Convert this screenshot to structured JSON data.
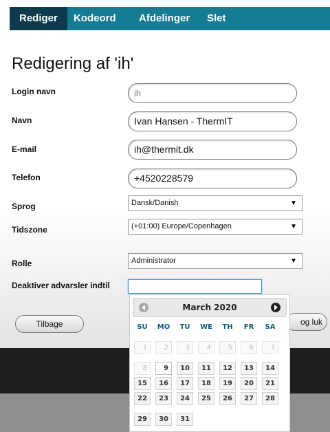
{
  "tabs": [
    {
      "label": "Rediger"
    },
    {
      "label": "Kodeord"
    },
    {
      "label": "Afdelinger"
    },
    {
      "label": "Slet"
    }
  ],
  "page_title": "Redigering af 'ih'",
  "form": {
    "login": {
      "label": "Login navn",
      "value": "ih"
    },
    "name": {
      "label": "Navn",
      "value": "Ivan Hansen - ThermIT"
    },
    "email": {
      "label": "E-mail",
      "value": "ih@thermit.dk"
    },
    "phone": {
      "label": "Telefon",
      "value": "+4520228579"
    },
    "language": {
      "label": "Sprog",
      "value": "Dansk/Danish"
    },
    "timezone": {
      "label": "Tidszone",
      "value": "(+01:00) Europe/Copenhagen"
    },
    "role": {
      "label": "Rolle",
      "value": "Administrator"
    },
    "disable_alerts": {
      "label": "Deaktiver advarsler indtil",
      "value": ""
    }
  },
  "buttons": {
    "back": "Tilbage",
    "save_close": "og luk"
  },
  "datepicker": {
    "month_title": "March 2020",
    "weekdays": [
      "SU",
      "MO",
      "TU",
      "WE",
      "TH",
      "FR",
      "SA"
    ],
    "weeks": [
      [
        "1",
        "2",
        "3",
        "4",
        "5",
        "6",
        "7"
      ],
      [
        "8",
        "9",
        "10",
        "11",
        "12",
        "13",
        "14"
      ],
      [
        "15",
        "16",
        "17",
        "18",
        "19",
        "20",
        "21"
      ],
      [
        "22",
        "23",
        "24",
        "25",
        "26",
        "27",
        "28"
      ],
      [
        "29",
        "30",
        "31"
      ]
    ],
    "disabled_through": "8",
    "today": "9"
  },
  "colors": {
    "tab_bar": "#157c94",
    "tab_active": "#0e3a4f",
    "weekday_text": "#0e5f7a"
  }
}
